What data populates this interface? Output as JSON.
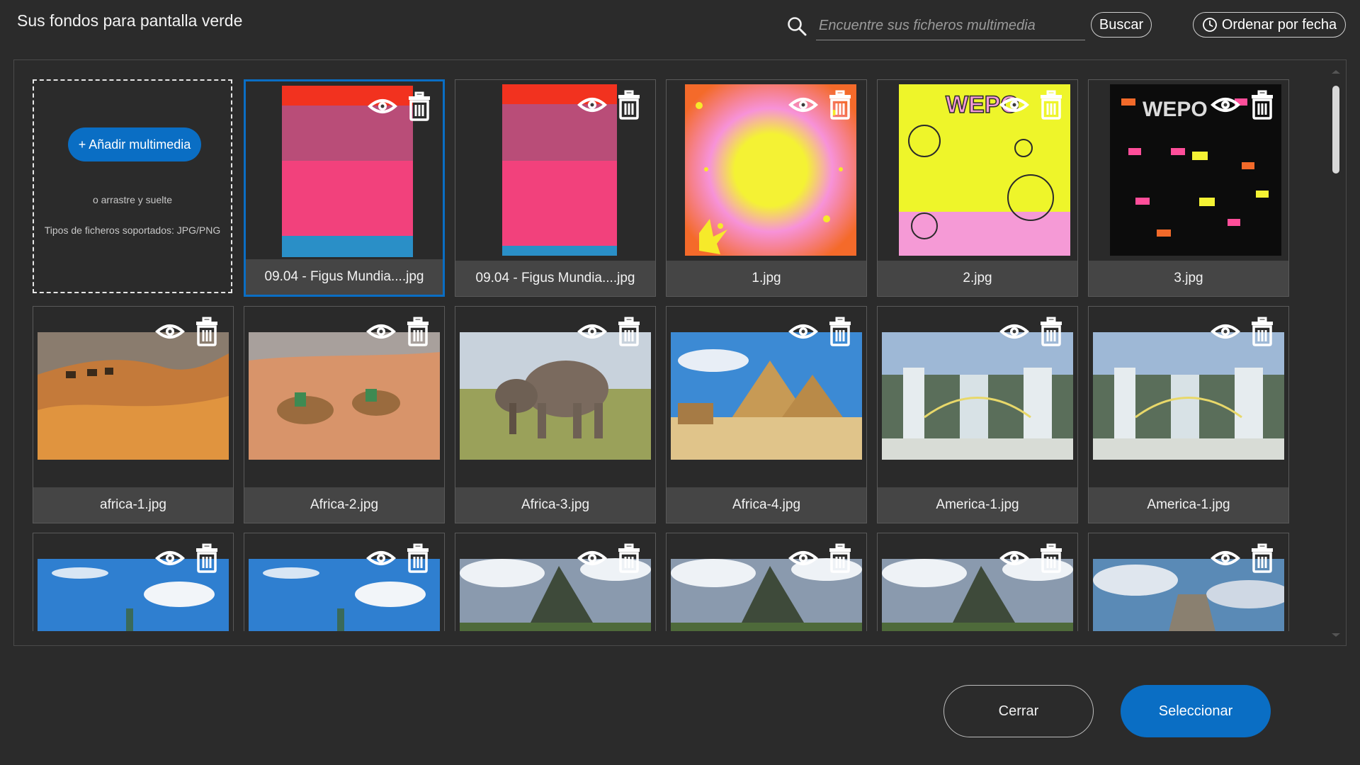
{
  "header": {
    "title": "Sus fondos para pantalla verde",
    "search_placeholder": "Encuentre sus ficheros multimedia",
    "search_button": "Buscar",
    "sort_button": "Ordenar por fecha"
  },
  "upload": {
    "add_button": "+ Añadir multimedia",
    "drag_text": "o arrastre y suelte",
    "types_text": "Tipos de ficheros soportados: JPG/PNG"
  },
  "tiles": [
    {
      "name": "09.04 - Figus Mundia....jpg",
      "kind": "stripes1",
      "selected": true
    },
    {
      "name": "09.04 - Figus Mundia....jpg",
      "kind": "stripes2"
    },
    {
      "name": "1.jpg",
      "kind": "burst"
    },
    {
      "name": "2.jpg",
      "kind": "smiley"
    },
    {
      "name": "3.jpg",
      "kind": "fiesta"
    },
    {
      "name": "africa-1.jpg",
      "kind": "desert1"
    },
    {
      "name": "Africa-2.jpg",
      "kind": "desert2"
    },
    {
      "name": "Africa-3.jpg",
      "kind": "elephants"
    },
    {
      "name": "Africa-4.jpg",
      "kind": "pyramids"
    },
    {
      "name": "America-1.jpg",
      "kind": "falls"
    },
    {
      "name": "America-1.jpg",
      "kind": "falls"
    },
    {
      "name": "",
      "kind": "liberty"
    },
    {
      "name": "",
      "kind": "liberty"
    },
    {
      "name": "",
      "kind": "machu"
    },
    {
      "name": "",
      "kind": "machu"
    },
    {
      "name": "",
      "kind": "machu"
    },
    {
      "name": "",
      "kind": "chichen"
    }
  ],
  "footer": {
    "close_button": "Cerrar",
    "select_button": "Seleccionar"
  },
  "colors": {
    "accent": "#0a6ec4",
    "background": "#2b2b2b",
    "caption_bg": "#454545"
  }
}
